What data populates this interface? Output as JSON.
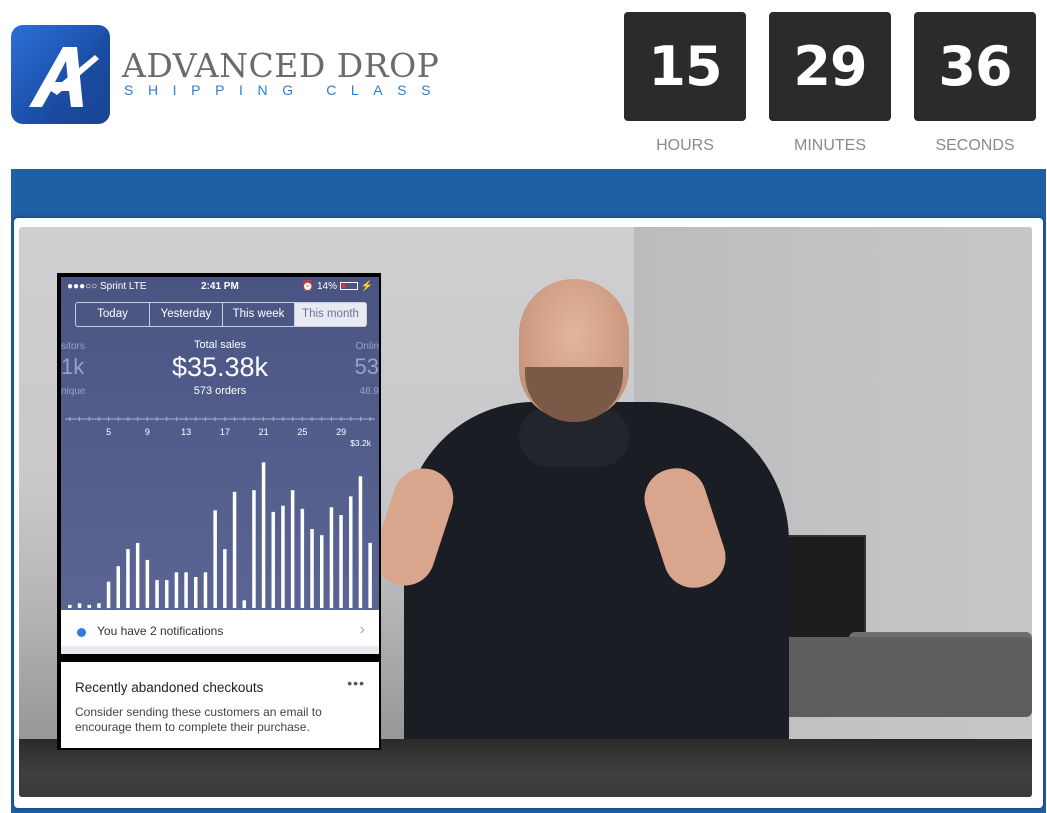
{
  "brand": {
    "title": "ADVANCED DROP",
    "subtitle": "SHIPPING CLASS",
    "logo_letter": "A"
  },
  "countdown": {
    "hours": "15",
    "minutes": "29",
    "seconds": "36",
    "hours_label": "HOURS",
    "minutes_label": "MINUTES",
    "seconds_label": "SECONDS"
  },
  "phone": {
    "carrier": "Sprint",
    "network": "LTE",
    "time": "2:41 PM",
    "battery": "14%",
    "tabs": [
      "Today",
      "Yesterday",
      "This week",
      "This month"
    ],
    "selected_tab": "This month",
    "total_label": "Total sales",
    "total_value": "$35.38k",
    "orders": "573 orders",
    "left_partial": [
      "sitors",
      "1k",
      "nique"
    ],
    "right_partial": [
      "Onlin",
      "53",
      "48.9"
    ],
    "notification_text": "You have 2 notifications",
    "card_title": "Recently abandoned checkouts",
    "card_body": "Consider sending these customers an email to encourage them to complete their purchase.",
    "card_menu": "•••",
    "chevron": "›"
  },
  "chart_data": {
    "type": "bar",
    "x_tick_labels": [
      "5",
      "9",
      "13",
      "17",
      "21",
      "25",
      "29"
    ],
    "annotation": "$3.2k",
    "values": [
      0.02,
      0.03,
      0.02,
      0.03,
      0.17,
      0.27,
      0.38,
      0.42,
      0.31,
      0.18,
      0.18,
      0.23,
      0.23,
      0.2,
      0.23,
      0.63,
      0.38,
      0.75,
      0.05,
      0.76,
      0.94,
      0.62,
      0.66,
      0.76,
      0.64,
      0.51,
      0.47,
      0.65,
      0.6,
      0.72,
      0.85,
      0.42
    ],
    "colors": {
      "bar": "#ffffff",
      "background": "#4f5a88"
    }
  },
  "colors": {
    "brand_blue": "#1f5fa5",
    "timer_bg": "#2b2b2b",
    "subtitle_blue": "#2d7fd0"
  }
}
